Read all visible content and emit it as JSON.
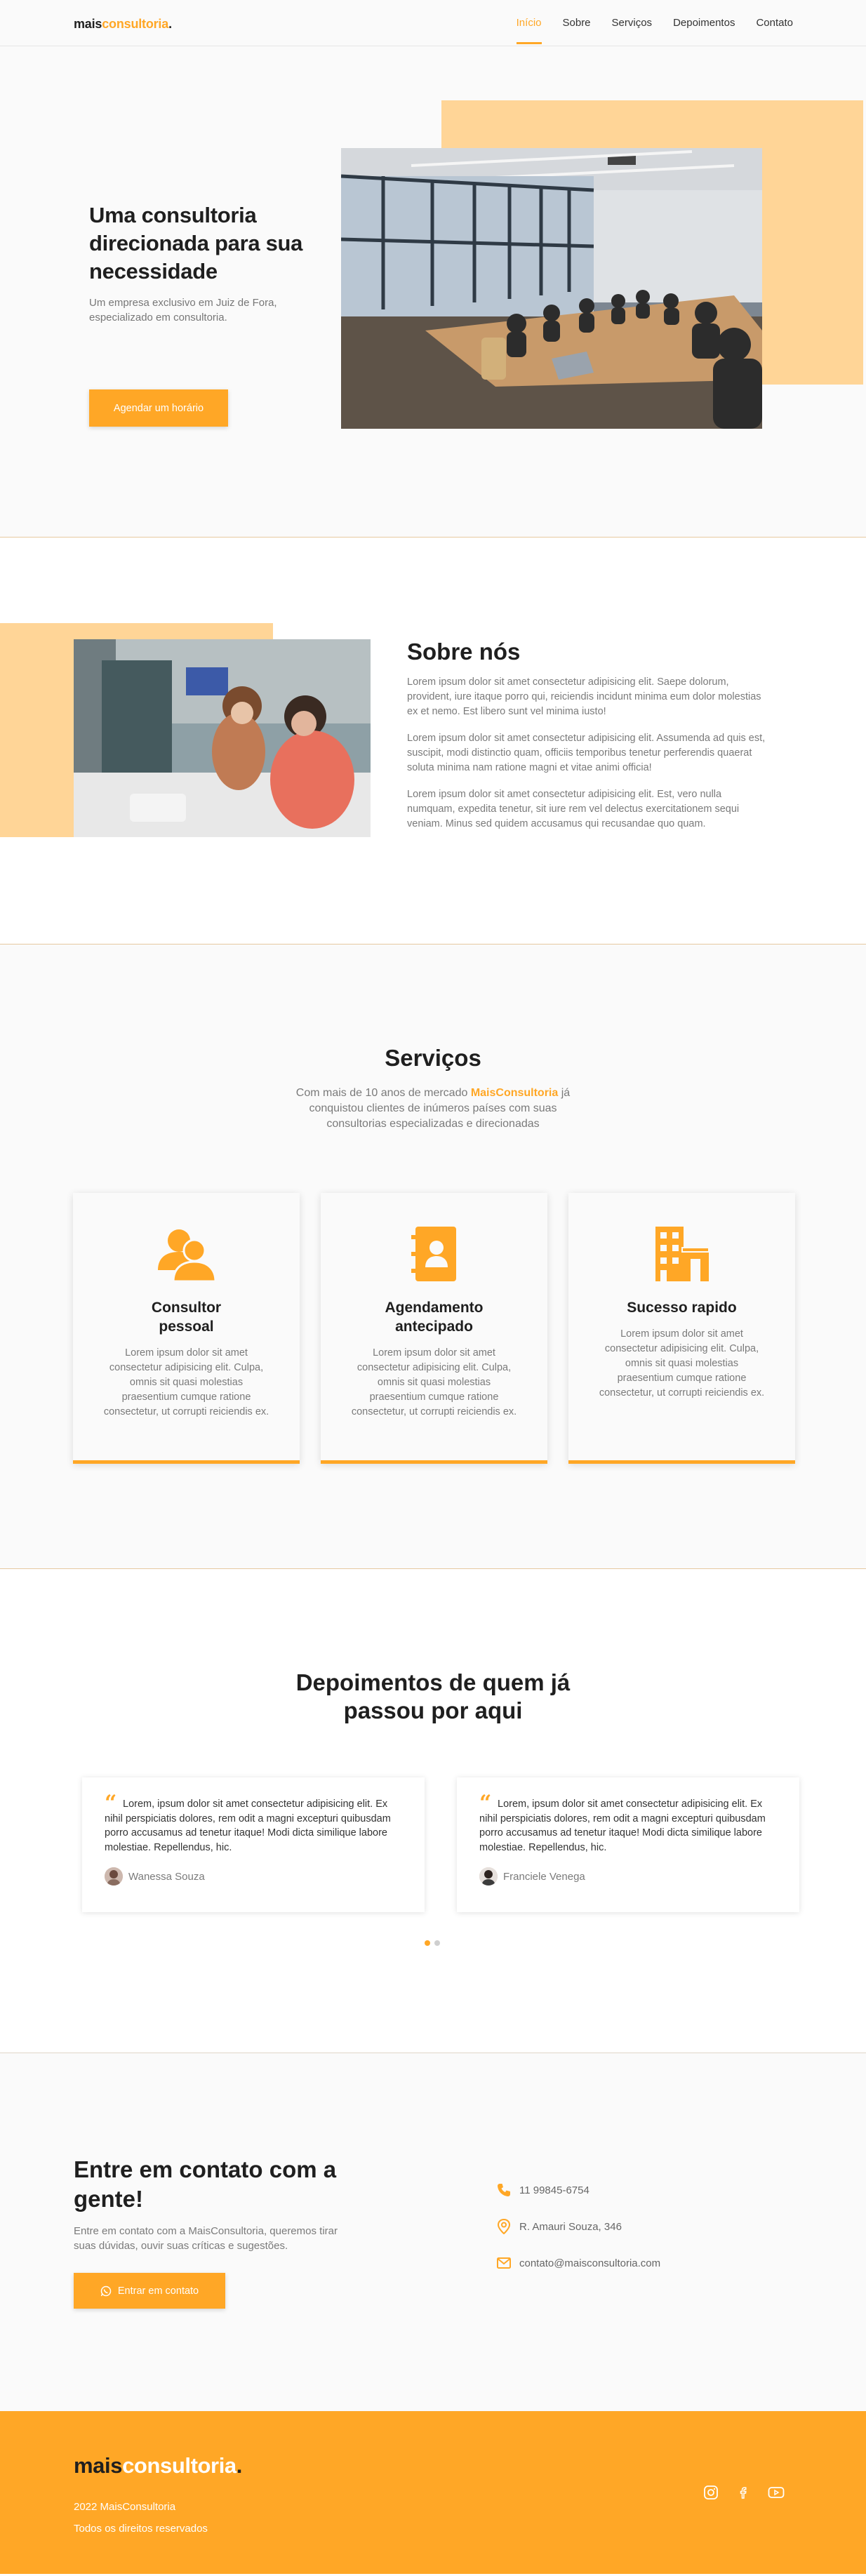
{
  "brand": {
    "part1": "mais",
    "part2": "consultoria",
    "part3": "."
  },
  "nav": {
    "items": [
      "Início",
      "Sobre",
      "Serviços",
      "Depoimentos",
      "Contato"
    ],
    "active": "Início"
  },
  "hero": {
    "title": "Uma consultoria direcionada para sua necessidade",
    "subtitle": "Um empresa exclusivo em Juiz de Fora, especializado em consultoria.",
    "button": "Agendar um horário",
    "image_alt": "photo-meeting-room"
  },
  "about": {
    "title": "Sobre nós",
    "paragraphs": [
      "Lorem ipsum dolor sit amet consectetur adipisicing elit. Saepe dolorum, provident, iure itaque porro qui, reiciendis incidunt minima eum dolor molestias ex et nemo. Est libero sunt vel minima iusto!",
      "Lorem ipsum dolor sit amet consectetur adipisicing elit. Assumenda ad quis est, suscipit, modi distinctio quam, officiis temporibus tenetur perferendis quaerat soluta minima nam ratione magni et vitae animi officia!",
      "Lorem ipsum dolor sit amet consectetur adipisicing elit. Est, vero nulla numquam, expedita tenetur, sit iure rem vel delectus exercitationem sequi veniam. Minus sed quidem accusamus qui recusandae quo quam."
    ]
  },
  "services": {
    "title": "Serviços",
    "subtitle_before": "Com mais de 10 anos de mercado ",
    "subtitle_brand": "MaisConsultoria",
    "subtitle_after": " já conquistou clientes de inúmeros países com suas consultorias especializadas e direcionadas",
    "cards": [
      {
        "icon": "users-icon",
        "title": "Consultor pessoal",
        "text": "Lorem ipsum dolor sit amet consectetur adipisicing elit. Culpa, omnis sit quasi molestias praesentium cumque ratione consectetur, ut corrupti reiciendis ex."
      },
      {
        "icon": "address-book-icon",
        "title": "Agendamento antecipado",
        "text": "Lorem ipsum dolor sit amet consectetur adipisicing elit. Culpa, omnis sit quasi molestias praesentium cumque ratione consectetur, ut corrupti reiciendis ex."
      },
      {
        "icon": "building-icon",
        "title": "Sucesso rapido",
        "text": "Lorem ipsum dolor sit amet consectetur adipisicing elit. Culpa, omnis sit quasi molestias praesentium cumque ratione consectetur, ut corrupti reiciendis ex."
      }
    ]
  },
  "testimonials": {
    "title": "Depoimentos de quem já passou por aqui",
    "items": [
      {
        "quote": "Lorem, ipsum dolor sit amet consectetur adipisicing elit. Ex nihil perspiciatis dolores, rem odit a magni excepturi quibusdam porro accusamus ad tenetur itaque! Modi dicta similique labore molestiae. Repellendus, hic.",
        "name": "Wanessa Souza"
      },
      {
        "quote": "Lorem, ipsum dolor sit amet consectetur adipisicing elit. Ex nihil perspiciatis dolores, rem odit a magni excepturi quibusdam porro accusamus ad tenetur itaque! Modi dicta similique labore molestiae. Repellendus, hic.",
        "name": "Franciele Venega"
      }
    ],
    "active_dot": 1,
    "dot_count": 2
  },
  "contact": {
    "title": "Entre em contato com a gente!",
    "subtitle": "Entre em contato com a MaisConsultoria, queremos tirar suas dúvidas, ouvir suas críticas e sugestões.",
    "button": "Entrar em contato",
    "items": [
      {
        "icon": "phone-icon",
        "text": "11 99845-6754"
      },
      {
        "icon": "map-pin-icon",
        "text": "R. Amauri Souza, 346"
      },
      {
        "icon": "mail-icon",
        "text": "contato@maisconsultoria.com"
      }
    ]
  },
  "footer": {
    "line1": "2022 MaisConsultoria",
    "line2": "Todos os direitos reservados",
    "social": [
      "instagram-icon",
      "facebook-icon",
      "youtube-icon"
    ]
  },
  "colors": {
    "accent": "#ffa726",
    "accent_light": "#ffd597",
    "background": "#fafafa"
  }
}
